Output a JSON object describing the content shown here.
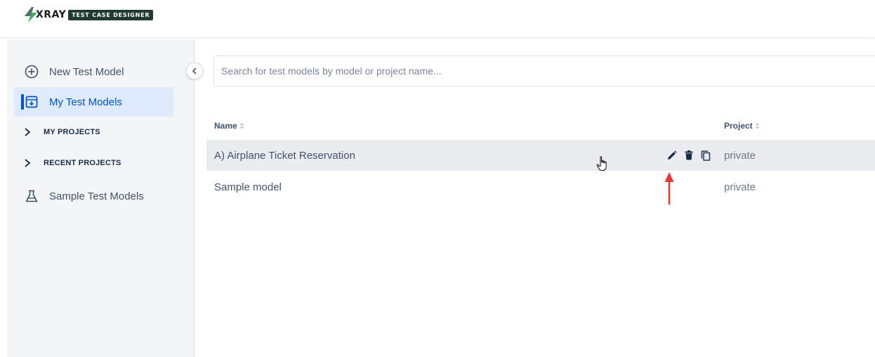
{
  "brand": {
    "wordmark": "XRAY",
    "badge": "TEST CASE DESIGNER"
  },
  "sidebar": {
    "items": [
      {
        "label": "New Test Model",
        "icon": "plus-circle-icon"
      },
      {
        "label": "My Test Models",
        "icon": "archive-box-icon",
        "active": true
      },
      {
        "label": "MY PROJECTS",
        "icon": "chevron-right-icon",
        "kind": "section"
      },
      {
        "label": "RECENT PROJECTS",
        "icon": "chevron-right-icon",
        "kind": "section"
      },
      {
        "label": "Sample Test Models",
        "icon": "flask-icon"
      }
    ]
  },
  "search": {
    "placeholder": "Search for test models by model or project name...",
    "value": ""
  },
  "table": {
    "columns": [
      {
        "label": "Name"
      },
      {
        "label": "Project"
      }
    ],
    "rows": [
      {
        "name": "A) Airplane Ticket Reservation",
        "project": "private",
        "actions": [
          "edit-icon",
          "trash-icon",
          "copy-icon"
        ],
        "hovered": true
      },
      {
        "name": "Sample model",
        "project": "private"
      }
    ]
  },
  "colors": {
    "accent": "#0052cc",
    "active_bg": "#deebff",
    "sidebar_bg": "#f4f5f7",
    "row_hover_bg": "#ebecf0",
    "annotation_arrow": "#e53935",
    "brand_bolt": "#3fae5a",
    "brand_badge_bg": "#1f3a2e"
  }
}
